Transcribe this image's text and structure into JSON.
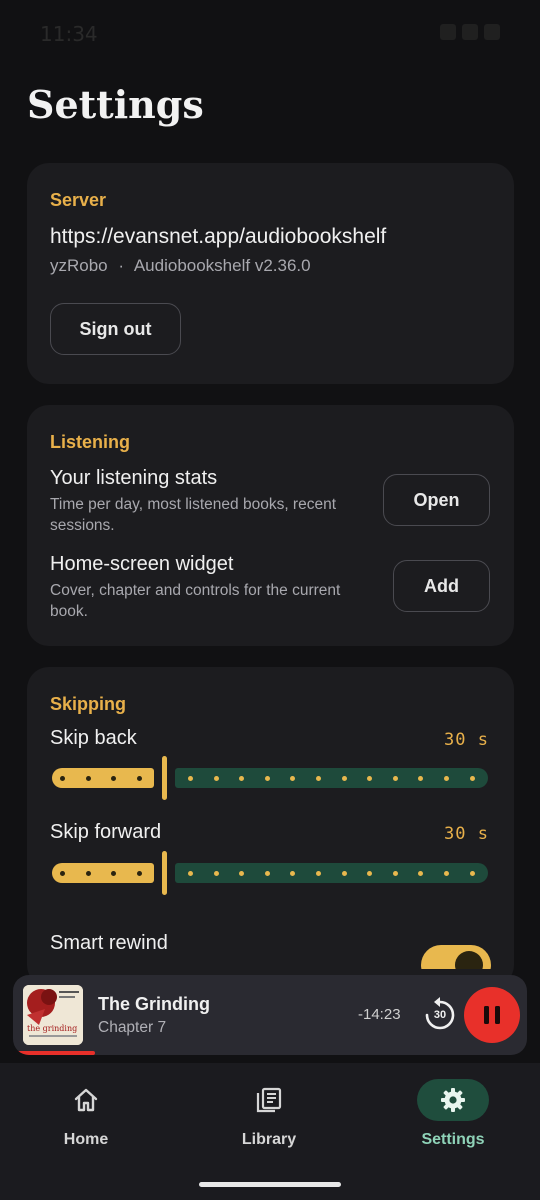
{
  "status_bar": {
    "time": "11:34"
  },
  "page": {
    "title": "Settings"
  },
  "server": {
    "section": "Server",
    "url": "https://evansnet.app/audiobookshelf",
    "user": "yzRobo",
    "separator": "·",
    "version": "Audiobookshelf v2.36.0",
    "sign_out_label": "Sign out"
  },
  "listening": {
    "section": "Listening",
    "stats_title": "Your listening stats",
    "stats_desc": "Time per day, most listened books, recent sessions.",
    "open_label": "Open",
    "widget_title": "Home-screen widget",
    "widget_desc": "Cover, chapter and controls for the current book.",
    "add_label": "Add"
  },
  "skipping": {
    "section": "Skipping",
    "skip_back_label": "Skip back",
    "skip_back_value": "30 s",
    "skip_back_fraction": 0.23,
    "skip_forward_label": "Skip forward",
    "skip_forward_value": "30 s",
    "skip_forward_fraction": 0.23,
    "smart_rewind_label": "Smart rewind",
    "smart_rewind_enabled": true
  },
  "now_playing": {
    "title": "The Grinding",
    "chapter": "Chapter 7",
    "remaining": "-14:23",
    "rewind_seconds": "30",
    "progress_fraction": 0.16,
    "cover_text": "the grinding"
  },
  "nav": {
    "home": "Home",
    "library": "Library",
    "settings": "Settings",
    "active": "settings"
  },
  "colors": {
    "accent": "#E8B04A",
    "active_nav": "#8FD3B8",
    "pause": "#E8302A",
    "slider_inactive": "#1E4A3B"
  }
}
